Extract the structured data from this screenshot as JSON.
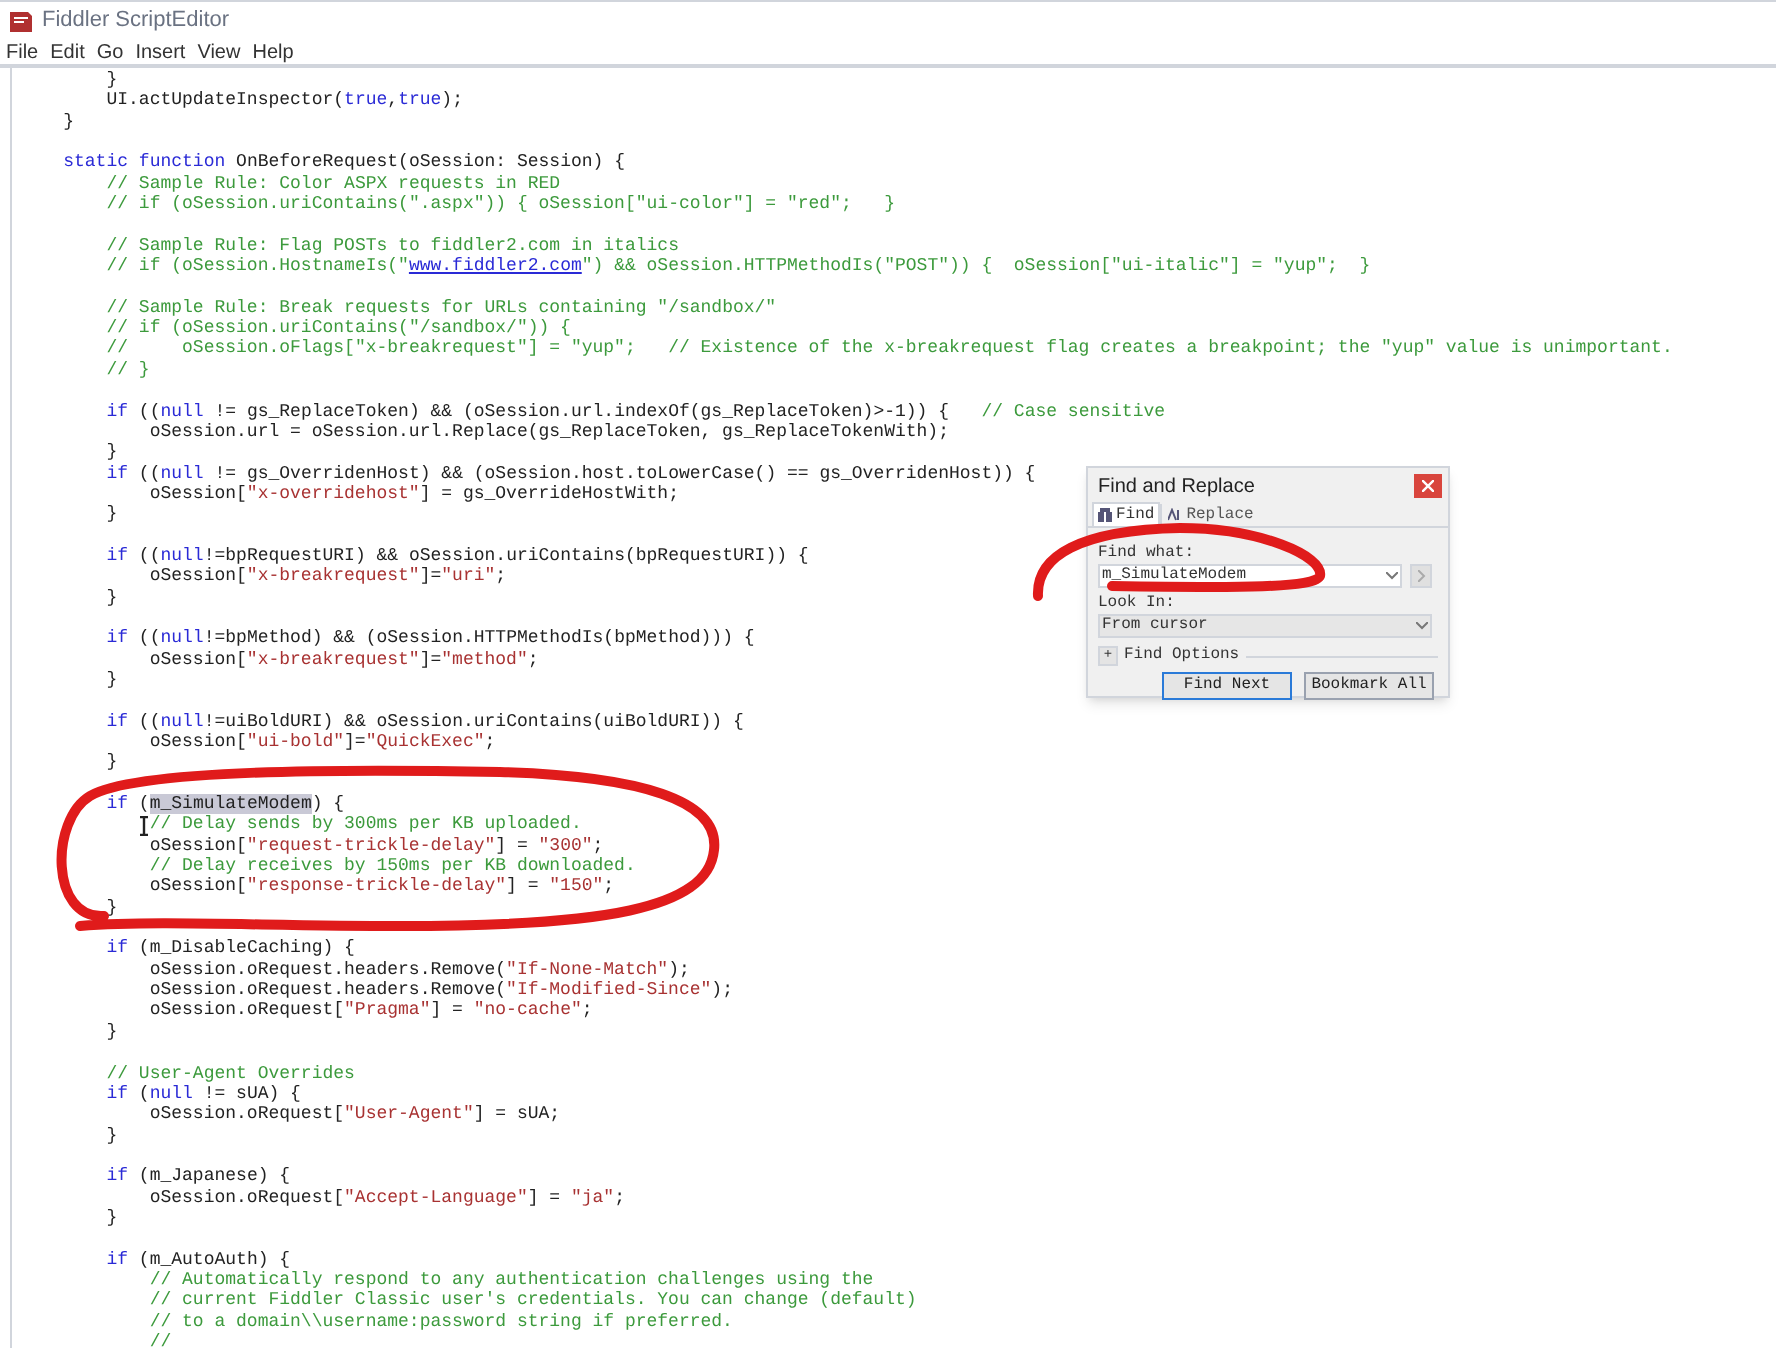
{
  "window": {
    "title": "Fiddler ScriptEditor"
  },
  "menu": [
    "File",
    "Edit",
    "Go",
    "Insert",
    "View",
    "Help"
  ],
  "code_lines": [
    {
      "segments": [
        {
          "kind": "code",
          "text": "        }"
        }
      ]
    },
    {
      "segments": [
        {
          "kind": "code",
          "text": "        UI.actUpdateInspector("
        },
        {
          "kind": "keyword",
          "text": "true"
        },
        {
          "kind": "code",
          "text": ","
        },
        {
          "kind": "keyword",
          "text": "true"
        },
        {
          "kind": "code",
          "text": ");"
        }
      ]
    },
    {
      "segments": [
        {
          "kind": "code",
          "text": "    }"
        }
      ]
    },
    {
      "kind": "blank"
    },
    {
      "segments": [
        {
          "kind": "keyword",
          "text": "    static "
        },
        {
          "kind": "keyword",
          "text": "function"
        },
        {
          "kind": "code",
          "text": " OnBeforeRequest(oSession: Session) {"
        }
      ]
    },
    {
      "segments": [
        {
          "kind": "comment",
          "text": "        // Sample Rule: Color ASPX requests in RED"
        }
      ]
    },
    {
      "segments": [
        {
          "kind": "comment",
          "text": "        // if (oSession.uriContains(\".aspx\")) { oSession[\"ui-color\"] = \"red\";   }"
        }
      ]
    },
    {
      "kind": "blank"
    },
    {
      "segments": [
        {
          "kind": "comment",
          "text": "        // Sample Rule: Flag POSTs to fiddler2.com in italics"
        }
      ]
    },
    {
      "segments": [
        {
          "kind": "comment",
          "text": "        // if (oSession.HostnameIs(\""
        },
        {
          "kind": "link",
          "text": "www.fiddler2.com"
        },
        {
          "kind": "comment",
          "text": "\") && oSession.HTTPMethodIs(\"POST\")) {  oSession[\"ui-italic\"] = \"yup\";  }"
        }
      ]
    },
    {
      "kind": "blank"
    },
    {
      "segments": [
        {
          "kind": "comment",
          "text": "        // Sample Rule: Break requests for URLs containing \"/sandbox/\""
        }
      ]
    },
    {
      "segments": [
        {
          "kind": "comment",
          "text": "        // if (oSession.uriContains(\"/sandbox/\")) {"
        }
      ]
    },
    {
      "segments": [
        {
          "kind": "comment",
          "text": "        //     oSession.oFlags[\"x-breakrequest\"] = \"yup\";   // Existence of the x-breakrequest flag creates a breakpoint; the \"yup\" value is unimportant."
        }
      ]
    },
    {
      "segments": [
        {
          "kind": "comment",
          "text": "        // }"
        }
      ]
    },
    {
      "kind": "blank"
    },
    {
      "segments": [
        {
          "kind": "keyword",
          "text": "        if"
        },
        {
          "kind": "code",
          "text": " (("
        },
        {
          "kind": "keyword",
          "text": "null"
        },
        {
          "kind": "code",
          "text": " != gs_ReplaceToken) && (oSession.url.indexOf(gs_ReplaceToken)>-1)) {   "
        },
        {
          "kind": "comment",
          "text": "// Case sensitive"
        }
      ]
    },
    {
      "segments": [
        {
          "kind": "code",
          "text": "            oSession.url = oSession.url.Replace(gs_ReplaceToken, gs_ReplaceTokenWith);"
        }
      ]
    },
    {
      "segments": [
        {
          "kind": "code",
          "text": "        }"
        }
      ]
    },
    {
      "segments": [
        {
          "kind": "keyword",
          "text": "        if"
        },
        {
          "kind": "code",
          "text": " (("
        },
        {
          "kind": "keyword",
          "text": "null"
        },
        {
          "kind": "code",
          "text": " != gs_OverridenHost) && (oSession.host.toLowerCase() == gs_OverridenHost)) {"
        }
      ]
    },
    {
      "segments": [
        {
          "kind": "code",
          "text": "            oSession["
        },
        {
          "kind": "string",
          "text": "\"x-overridehost\""
        },
        {
          "kind": "code",
          "text": "] = gs_OverrideHostWith;"
        }
      ]
    },
    {
      "segments": [
        {
          "kind": "code",
          "text": "        }"
        }
      ]
    },
    {
      "kind": "blank"
    },
    {
      "segments": [
        {
          "kind": "keyword",
          "text": "        if"
        },
        {
          "kind": "code",
          "text": " (("
        },
        {
          "kind": "keyword",
          "text": "null"
        },
        {
          "kind": "code",
          "text": "!=bpRequestURI) && oSession.uriContains(bpRequestURI)) {"
        }
      ]
    },
    {
      "segments": [
        {
          "kind": "code",
          "text": "            oSession["
        },
        {
          "kind": "string",
          "text": "\"x-breakrequest\""
        },
        {
          "kind": "code",
          "text": "]="
        },
        {
          "kind": "string",
          "text": "\"uri\""
        },
        {
          "kind": "code",
          "text": ";"
        }
      ]
    },
    {
      "segments": [
        {
          "kind": "code",
          "text": "        }"
        }
      ]
    },
    {
      "kind": "blank"
    },
    {
      "segments": [
        {
          "kind": "keyword",
          "text": "        if"
        },
        {
          "kind": "code",
          "text": " (("
        },
        {
          "kind": "keyword",
          "text": "null"
        },
        {
          "kind": "code",
          "text": "!=bpMethod) && (oSession.HTTPMethodIs(bpMethod))) {"
        }
      ]
    },
    {
      "segments": [
        {
          "kind": "code",
          "text": "            oSession["
        },
        {
          "kind": "string",
          "text": "\"x-breakrequest\""
        },
        {
          "kind": "code",
          "text": "]="
        },
        {
          "kind": "string",
          "text": "\"method\""
        },
        {
          "kind": "code",
          "text": ";"
        }
      ]
    },
    {
      "segments": [
        {
          "kind": "code",
          "text": "        }"
        }
      ]
    },
    {
      "kind": "blank"
    },
    {
      "segments": [
        {
          "kind": "keyword",
          "text": "        if"
        },
        {
          "kind": "code",
          "text": " (("
        },
        {
          "kind": "keyword",
          "text": "null"
        },
        {
          "kind": "code",
          "text": "!=uiBoldURI) && oSession.uriContains(uiBoldURI)) {"
        }
      ]
    },
    {
      "segments": [
        {
          "kind": "code",
          "text": "            oSession["
        },
        {
          "kind": "string",
          "text": "\"ui-bold\""
        },
        {
          "kind": "code",
          "text": "]="
        },
        {
          "kind": "string",
          "text": "\"QuickExec\""
        },
        {
          "kind": "code",
          "text": ";"
        }
      ]
    },
    {
      "segments": [
        {
          "kind": "code",
          "text": "        }"
        }
      ]
    },
    {
      "kind": "blank"
    },
    {
      "segments": [
        {
          "kind": "keyword",
          "text": "        if"
        },
        {
          "kind": "code",
          "text": " ("
        },
        {
          "kind": "selection",
          "text": "m_SimulateModem"
        },
        {
          "kind": "code",
          "text": ") {"
        }
      ]
    },
    {
      "segments": [
        {
          "kind": "comment",
          "text": "            // Delay sends by 300ms per KB uploaded."
        }
      ]
    },
    {
      "segments": [
        {
          "kind": "code",
          "text": "            oSession["
        },
        {
          "kind": "string",
          "text": "\"request-trickle-delay\""
        },
        {
          "kind": "code",
          "text": "] = "
        },
        {
          "kind": "string",
          "text": "\"300\""
        },
        {
          "kind": "code",
          "text": ";"
        }
      ]
    },
    {
      "segments": [
        {
          "kind": "comment",
          "text": "            // Delay receives by 150ms per KB downloaded."
        }
      ]
    },
    {
      "segments": [
        {
          "kind": "code",
          "text": "            oSession["
        },
        {
          "kind": "string",
          "text": "\"response-trickle-delay\""
        },
        {
          "kind": "code",
          "text": "] = "
        },
        {
          "kind": "string",
          "text": "\"150\""
        },
        {
          "kind": "code",
          "text": ";"
        }
      ]
    },
    {
      "segments": [
        {
          "kind": "code",
          "text": "        }"
        }
      ]
    },
    {
      "kind": "blank"
    },
    {
      "segments": [
        {
          "kind": "keyword",
          "text": "        if"
        },
        {
          "kind": "code",
          "text": " (m_DisableCaching) {"
        }
      ]
    },
    {
      "segments": [
        {
          "kind": "code",
          "text": "            oSession.oRequest.headers.Remove("
        },
        {
          "kind": "string",
          "text": "\"If-None-Match\""
        },
        {
          "kind": "code",
          "text": ");"
        }
      ]
    },
    {
      "segments": [
        {
          "kind": "code",
          "text": "            oSession.oRequest.headers.Remove("
        },
        {
          "kind": "string",
          "text": "\"If-Modified-Since\""
        },
        {
          "kind": "code",
          "text": ");"
        }
      ]
    },
    {
      "segments": [
        {
          "kind": "code",
          "text": "            oSession.oRequest["
        },
        {
          "kind": "string",
          "text": "\"Pragma\""
        },
        {
          "kind": "code",
          "text": "] = "
        },
        {
          "kind": "string",
          "text": "\"no-cache\""
        },
        {
          "kind": "code",
          "text": ";"
        }
      ]
    },
    {
      "segments": [
        {
          "kind": "code",
          "text": "        }"
        }
      ]
    },
    {
      "kind": "blank"
    },
    {
      "segments": [
        {
          "kind": "comment",
          "text": "        // User-Agent Overrides"
        }
      ]
    },
    {
      "segments": [
        {
          "kind": "keyword",
          "text": "        if"
        },
        {
          "kind": "code",
          "text": " ("
        },
        {
          "kind": "keyword",
          "text": "null"
        },
        {
          "kind": "code",
          "text": " != sUA) {"
        }
      ]
    },
    {
      "segments": [
        {
          "kind": "code",
          "text": "            oSession.oRequest["
        },
        {
          "kind": "string",
          "text": "\"User-Agent\""
        },
        {
          "kind": "code",
          "text": "] = sUA;"
        }
      ]
    },
    {
      "segments": [
        {
          "kind": "code",
          "text": "        }"
        }
      ]
    },
    {
      "kind": "blank"
    },
    {
      "segments": [
        {
          "kind": "keyword",
          "text": "        if"
        },
        {
          "kind": "code",
          "text": " (m_Japanese) {"
        }
      ]
    },
    {
      "segments": [
        {
          "kind": "code",
          "text": "            oSession.oRequest["
        },
        {
          "kind": "string",
          "text": "\"Accept-Language\""
        },
        {
          "kind": "code",
          "text": "] = "
        },
        {
          "kind": "string",
          "text": "\"ja\""
        },
        {
          "kind": "code",
          "text": ";"
        }
      ]
    },
    {
      "segments": [
        {
          "kind": "code",
          "text": "        }"
        }
      ]
    },
    {
      "kind": "blank"
    },
    {
      "segments": [
        {
          "kind": "keyword",
          "text": "        if"
        },
        {
          "kind": "code",
          "text": " (m_AutoAuth) {"
        }
      ]
    },
    {
      "segments": [
        {
          "kind": "comment",
          "text": "            // Automatically respond to any authentication challenges using the"
        }
      ]
    },
    {
      "segments": [
        {
          "kind": "comment",
          "text": "            // current Fiddler Classic user's credentials. You can change (default)"
        }
      ]
    },
    {
      "segments": [
        {
          "kind": "comment",
          "text": "            // to a domain\\\\username:password string if preferred."
        }
      ]
    },
    {
      "segments": [
        {
          "kind": "comment",
          "text": "            //"
        }
      ]
    }
  ],
  "find_dialog": {
    "title": "Find and Replace",
    "tabs": [
      {
        "label": "Find",
        "selected": true
      },
      {
        "label": "Replace",
        "selected": false
      }
    ],
    "find_what_label": "Find what:",
    "find_what_value": "m_SimulateModem",
    "look_in_label": "Look In:",
    "look_in_value": "From cursor",
    "expander_symbol": "+",
    "options_label": "Find Options",
    "buttons": [
      {
        "label": "Find Next",
        "focused": true
      },
      {
        "label": "Bookmark All",
        "focused": false
      }
    ]
  }
}
